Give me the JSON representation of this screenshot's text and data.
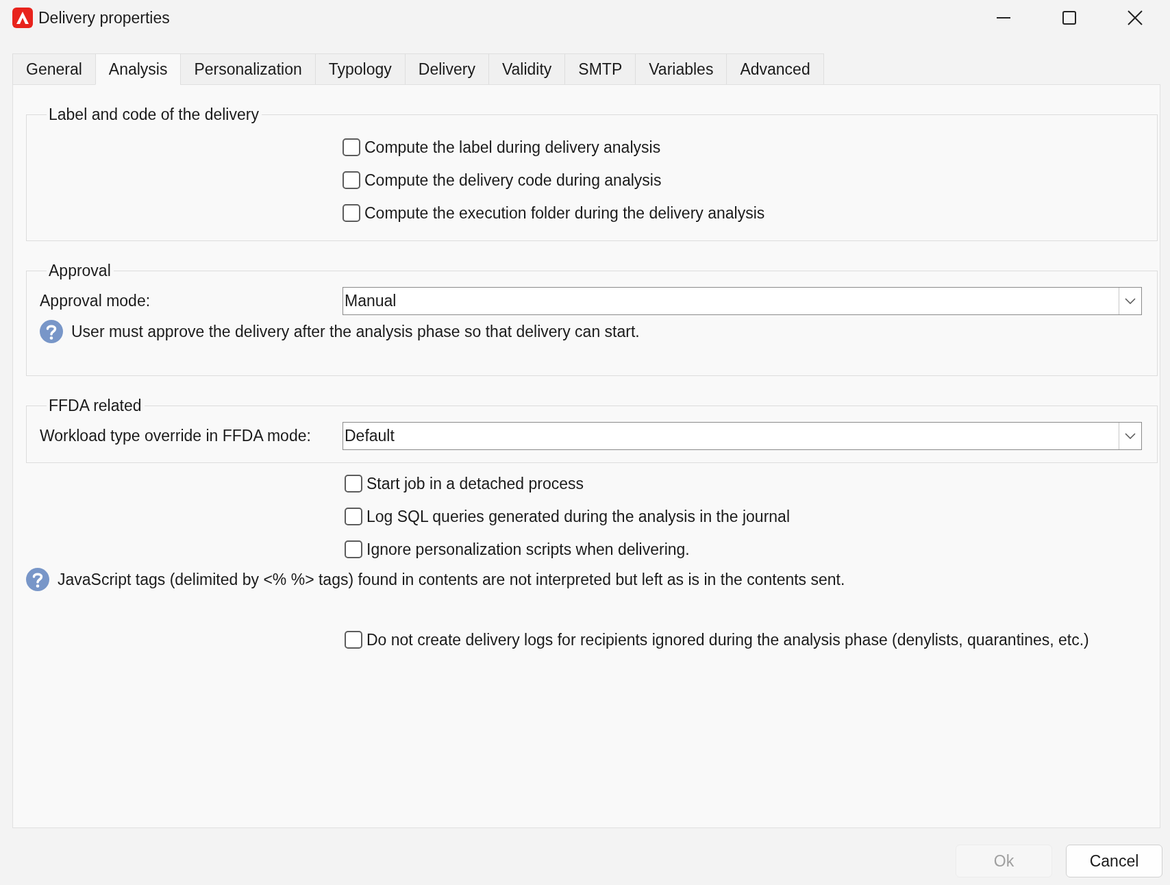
{
  "window": {
    "title": "Delivery properties"
  },
  "tabs": [
    {
      "label": "General",
      "selected": false
    },
    {
      "label": "Analysis",
      "selected": true
    },
    {
      "label": "Personalization",
      "selected": false
    },
    {
      "label": "Typology",
      "selected": false
    },
    {
      "label": "Delivery",
      "selected": false
    },
    {
      "label": "Validity",
      "selected": false
    },
    {
      "label": "SMTP",
      "selected": false
    },
    {
      "label": "Variables",
      "selected": false
    },
    {
      "label": "Advanced",
      "selected": false
    }
  ],
  "sections": [
    {
      "kind": "group",
      "legend": "Label and code of the delivery",
      "items": [
        {
          "kind": "checkbox",
          "label": "Compute the label during delivery analysis",
          "checked": false
        },
        {
          "kind": "checkbox",
          "label": "Compute the delivery code during analysis",
          "checked": false
        },
        {
          "kind": "checkbox",
          "label": "Compute the execution folder during the delivery analysis",
          "checked": false
        }
      ]
    },
    {
      "kind": "group",
      "legend": "Approval",
      "items": [
        {
          "kind": "dropdown",
          "label": "Approval mode:",
          "value": "Manual"
        },
        {
          "kind": "help",
          "text": "User must approve the delivery after the analysis phase so that delivery can start."
        }
      ]
    },
    {
      "kind": "group",
      "legend": "FFDA related",
      "items": [
        {
          "kind": "dropdown",
          "label": "Workload type override in FFDA mode:",
          "value": "Default"
        }
      ]
    },
    {
      "kind": "checkbox",
      "label": "Start job in a detached process",
      "checked": false
    },
    {
      "kind": "checkbox",
      "label": "Log SQL queries generated during the analysis in the journal",
      "checked": false
    },
    {
      "kind": "checkbox",
      "label": "Ignore personalization scripts when delivering.",
      "checked": false
    },
    {
      "kind": "help",
      "text": "JavaScript tags (delimited by <% %> tags) found in contents are not interpreted but left as is in the contents sent."
    },
    {
      "kind": "checkbox",
      "label": "Do not create delivery logs for recipients ignored during the analysis phase (denylists, quarantines, etc.)",
      "checked": false
    }
  ],
  "buttons": [
    {
      "label": "Ok",
      "disabled": true
    },
    {
      "label": "Cancel",
      "disabled": false
    }
  ]
}
